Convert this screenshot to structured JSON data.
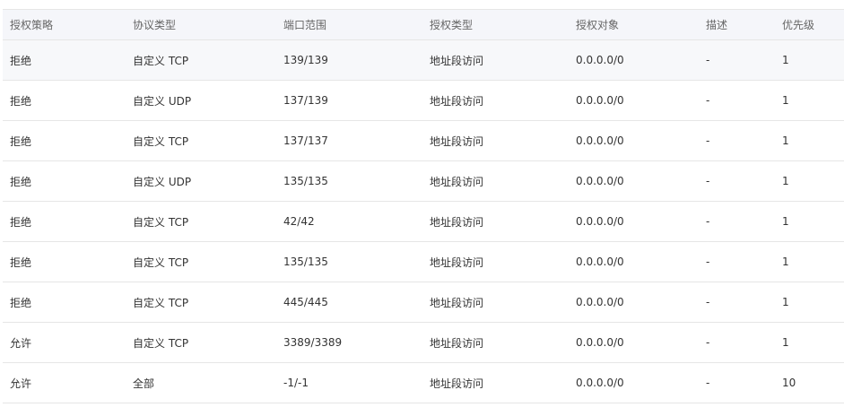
{
  "table": {
    "headers": [
      "授权策略",
      "协议类型",
      "端口范围",
      "授权类型",
      "授权对象",
      "描述",
      "优先级"
    ],
    "rows": [
      [
        "拒绝",
        "自定义 TCP",
        "139/139",
        "地址段访问",
        "0.0.0.0/0",
        "-",
        "1"
      ],
      [
        "拒绝",
        "自定义 UDP",
        "137/139",
        "地址段访问",
        "0.0.0.0/0",
        "-",
        "1"
      ],
      [
        "拒绝",
        "自定义 TCP",
        "137/137",
        "地址段访问",
        "0.0.0.0/0",
        "-",
        "1"
      ],
      [
        "拒绝",
        "自定义 UDP",
        "135/135",
        "地址段访问",
        "0.0.0.0/0",
        "-",
        "1"
      ],
      [
        "拒绝",
        "自定义 TCP",
        "42/42",
        "地址段访问",
        "0.0.0.0/0",
        "-",
        "1"
      ],
      [
        "拒绝",
        "自定义 TCP",
        "135/135",
        "地址段访问",
        "0.0.0.0/0",
        "-",
        "1"
      ],
      [
        "拒绝",
        "自定义 TCP",
        "445/445",
        "地址段访问",
        "0.0.0.0/0",
        "-",
        "1"
      ],
      [
        "允许",
        "自定义 TCP",
        "3389/3389",
        "地址段访问",
        "0.0.0.0/0",
        "-",
        "1"
      ],
      [
        "允许",
        "全部",
        "-1/-1",
        "地址段访问",
        "0.0.0.0/0",
        "-",
        "10"
      ]
    ]
  }
}
